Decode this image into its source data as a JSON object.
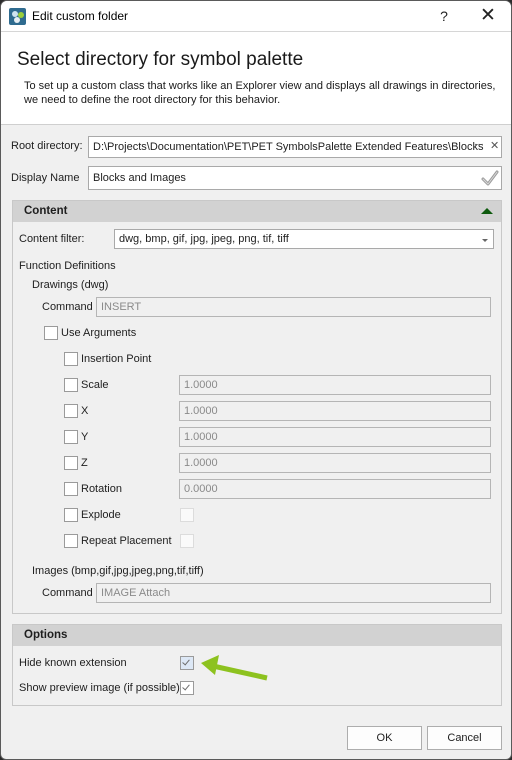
{
  "window": {
    "title": "Edit custom folder",
    "help_label": "?",
    "close_label": "✕",
    "app_icon": "gears-icon"
  },
  "header": {
    "title": "Select directory for symbol palette",
    "description": "To set up a custom class that works like an Explorer view and displays all drawings in directories, we need to define the root directory for this behavior."
  },
  "root_directory": {
    "label": "Root directory:",
    "value": "D:\\Projects\\Documentation\\PET\\PET SymbolsPalette Extended Features\\Blocks",
    "browse_label": "···",
    "clear_label": "✕"
  },
  "display_name": {
    "label": "Display Name",
    "value": "Blocks and Images",
    "confirm_icon": "checkmark-icon"
  },
  "content": {
    "header": "Content",
    "filter_label": "Content filter:",
    "filter_value": "dwg, bmp, gif, jpg, jpeg, png, tif, tiff",
    "function_definitions": "Function Definitions",
    "drawings": {
      "label": "Drawings (dwg)",
      "command_label": "Command",
      "command_value": "INSERT",
      "use_arguments_label": "Use Arguments",
      "use_arguments_checked": false,
      "arguments": [
        {
          "label": "Insertion Point",
          "checked": false,
          "value": null
        },
        {
          "label": "Scale",
          "checked": false,
          "value": "1.0000"
        },
        {
          "label": "X",
          "checked": false,
          "value": "1.0000"
        },
        {
          "label": "Y",
          "checked": false,
          "value": "1.0000"
        },
        {
          "label": "Z",
          "checked": false,
          "value": "1.0000"
        },
        {
          "label": "Rotation",
          "checked": false,
          "value": "0.0000"
        },
        {
          "label": "Explode",
          "checked": false,
          "value_checked": false
        },
        {
          "label": "Repeat Placement",
          "checked": false,
          "value_checked": false
        }
      ]
    },
    "images": {
      "label": "Images (bmp,gif,jpg,jpeg,png,tif,tiff)",
      "command_label": "Command",
      "command_value": "IMAGE Attach"
    }
  },
  "options": {
    "header": "Options",
    "hide_known_extension_label": "Hide known extension",
    "hide_known_extension_checked": true,
    "show_preview_label": "Show preview image (if possible)",
    "show_preview_checked": true,
    "annotation_arrow_color": "#8dc21f"
  },
  "buttons": {
    "ok": "OK",
    "cancel": "Cancel"
  }
}
